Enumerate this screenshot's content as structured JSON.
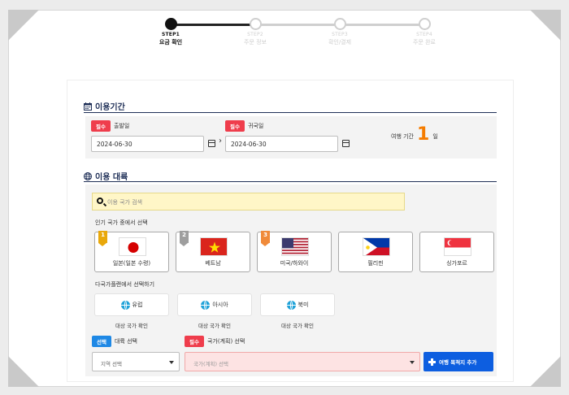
{
  "steps": [
    {
      "name": "STEP1",
      "label": "요금 확인",
      "active": true
    },
    {
      "name": "STEP2",
      "label": "주문 정보",
      "active": false
    },
    {
      "name": "STEP3",
      "label": "확인/결제",
      "active": false
    },
    {
      "name": "STEP4",
      "label": "주문 완료",
      "active": false
    }
  ],
  "period": {
    "title": "이용기간",
    "required_label": "필수",
    "departure_label": "출발일",
    "departure_value": "2024-06-30",
    "return_label": "귀국일",
    "return_value": "2024-06-30",
    "arrow": "›",
    "duration_label": "여행 기간",
    "duration_value": "1",
    "duration_unit": "일"
  },
  "region": {
    "title": "이용 대륙",
    "search_placeholder": "이용 국가 검색",
    "popular_label": "인기 국가 중에서 선택",
    "countries": [
      {
        "rank": "1",
        "name": "일본(일본 수령)"
      },
      {
        "rank": "2",
        "name": "베트남"
      },
      {
        "rank": "3",
        "name": "미국/하와이"
      },
      {
        "rank": "",
        "name": "필리핀"
      },
      {
        "rank": "",
        "name": "싱가포르"
      }
    ],
    "multi_label": "다국가플랜에서 선택하기",
    "multi_plans": [
      {
        "name": "유럽",
        "link": "대상 국가 확인"
      },
      {
        "name": "아시아",
        "link": "대상 국가 확인"
      },
      {
        "name": "북미",
        "link": "대상 국가 확인"
      }
    ],
    "continent_badge": "선택",
    "continent_label": "대륙 선택",
    "continent_placeholder": "지역 선택",
    "country_badge": "필수",
    "country_label": "국가(계획) 선택",
    "country_placeholder": "국가(계획) 선택",
    "add_button": "여행 목적지 추가"
  },
  "colors": {
    "accent": "#1f2f57",
    "required": "#ef3d4c",
    "optional": "#1e88e5",
    "duration": "#f57c00",
    "primary_button": "#0d5ee0"
  }
}
